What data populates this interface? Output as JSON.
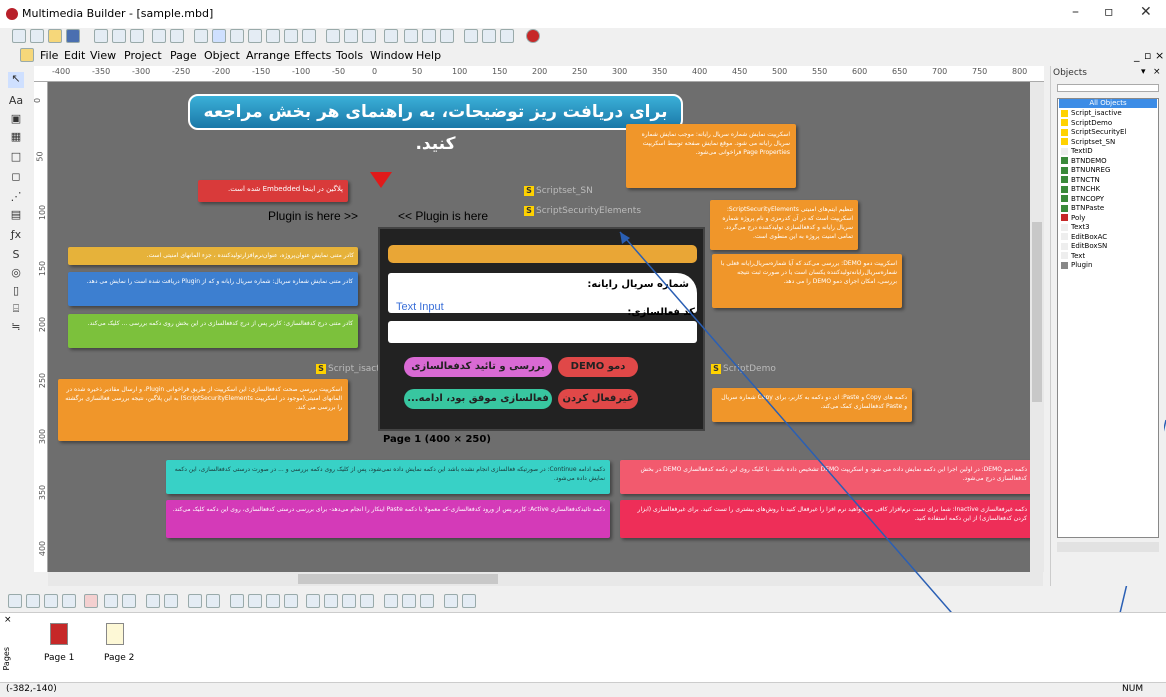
{
  "window": {
    "title": "Multimedia Builder - [sample.mbd]",
    "minimize": "–",
    "maximize": "▫",
    "close": "✕"
  },
  "menu": [
    "File",
    "Edit",
    "View",
    "Project",
    "Page",
    "Object",
    "Arrange",
    "Effects",
    "Tools",
    "Window",
    "Help"
  ],
  "ruler": [
    "-400",
    "-350",
    "-300",
    "-250",
    "-200",
    "-150",
    "-100",
    "-50",
    "0",
    "50",
    "100",
    "150",
    "200",
    "250",
    "300",
    "350",
    "400",
    "450",
    "500",
    "550",
    "600",
    "650",
    "700",
    "750",
    "800"
  ],
  "vruler": [
    "0",
    "50",
    "100",
    "150",
    "200",
    "250",
    "300",
    "350",
    "400"
  ],
  "canvas": {
    "banner": "برای دریافت ریز توضیحات، به راهنمای هر بخش مراجعه کنید.",
    "plugin_embedded_note": "پلاگین در اینجا Embedded شده است.",
    "plugin_left": "Plugin is here >>",
    "plugin_right": "<< Plugin is here",
    "script_sn": "Scriptset_SN",
    "script_security": "ScriptSecurityElements",
    "script_isactive": "Script_isactive",
    "script_demo": "ScriptDemo",
    "frame": {
      "serial_label": "شماره سریال رایانه:",
      "text_input": "Text Input",
      "activation_label": "کد فعالسازی:",
      "btn_demo": "دمو DEMO",
      "btn_check": "بررسی و تائید کدفعالسازی",
      "btn_disable": "غیرفعال کردن",
      "btn_success": "فعالسازی موفق بود، ادامه..."
    },
    "page_label": "Page 1 (400 × 250)",
    "notes": {
      "orange_top": "اسکریپت نمایش شماره سریال رایانه: موجب نمایش شماره سریال رایانه می شود. موقع نمایش صفحه توسط اسکریپت Page Properties فراخوانی می‌شود.",
      "orange_security": "تنظیم ایتم‌های امنیتی ScriptSecurityElements: اسکریپت است که در آن کدرمزی و نام پروژه شماره سریال رایانه و کدفعالسازی تولیدکننده درج می‌گردد. تمامی امنیت پروژه به این منطوی است.",
      "yellow_left": "کادر متنی نمایش عنوان‌پروژه، عنوان‌نرم‌افزار‌تولیدکننده ، جزء المانهای امنیتی است.",
      "blue_left": "کادر متنی نمایش شماره سریال: شماره سریال رایانه و که از Plugin دریافت شده است را نمایش می دهد.",
      "green_left": "کادر متنی درج کدفعالسازی: کاربر پس از درج کدفعالسازی در این بخش روی دکمه بررسی ... کلیک می‌کند.",
      "orange_left": "اسکریپت بررسی صحت کدفعالسازی: این اسکریپت از طریق فراخوانی Plugin، و ارسال مقادیر ذخیره شده در المانهای امنیتی(موجود در اسکریپت ScriptSecurityElements) به این پلاگین، نتیجه بررسی فعالسازی برگشته را بررسی می کند.",
      "orange_demo": "اسکریپت دمو DEMO: بررسی می‌کند که آیا شماره‌سریال‌رایانه فعلی با شماره‌سریال‌رایانه‌تولیدکننده یکسان است یا در صورت ثبت نتیجه بررسی، امکان اجرای دمو DEMO را می دهد.",
      "orange_copy": "دکمه های Copy و Paste: ای دو دکمه به کاربر، برای Copy شماره سریال و Paste کدفعالسازی کمک می‌کند.",
      "cyan_continue": "دکمه ادامه Continue: در صورتیکه فعالسازی انجام نشده باشد این دکمه نمایش داده نمی‌شود، پس از کلیک روی دکمه بررسی و ... در صورت درستی کدفعالسازی، این دکمه نمایش داده می‌شود.",
      "red_demo": "دکمه دمو DEMO: در اولین اجرا این دکمه نمایش داده می شود و اسکریپت DEMO تشخیص داده باشد. با کلیک روی این دکمه کدفعالسازی DEMO در بخش کدفعالسازی درج می‌شود.",
      "magenta_active": "دکمه تائیدکدفعالسازی Active: کاربر پس از ورود کدفعالسازی-که معمولا با دکمه Paste اینکار را انجام می‌دهد- برای بررسی درستی کدفعالسازی، روی این دکمه کلیک می‌کند.",
      "red_inactive": "دکمه غیرفعالسازی Inactive: شما برای تست نرم‌افزار کافی می‌خواهید نرم افزا را غیرفعال کنید تا روش‌های بیشتری را تست کنید. برای غیرفعالسازی (ابزار کردن کدفعالسازی) از این دکمه استفاده کنید."
    }
  },
  "objects_panel": {
    "header": "Objects",
    "selected": "All Objects",
    "items": [
      "Script_isactive",
      "ScriptDemo",
      "ScriptSecurityEl",
      "Scriptset_SN",
      "TextID",
      "BTNDEMO",
      "BTNUNREG",
      "BTNCTN",
      "BTNCHK",
      "BTNCOPY",
      "BTNPaste",
      "Poly",
      "Text3",
      "EditBoxAC",
      "EditBoxSN",
      "Text",
      "Plugin"
    ]
  },
  "pages": [
    "Page 1",
    "Page 2"
  ],
  "pages_tab": "Pages",
  "status": {
    "coords": "(-382,-140)",
    "num": "NUM"
  },
  "colors": {
    "orange": "#f0962a",
    "red": "#d93a3a",
    "blue": "#3d7fd0",
    "green": "#7cc13c",
    "cyan": "#38d1c6",
    "magenta": "#d43ab8",
    "pink": "#f25a6e",
    "canvas": "#6e6e6e"
  }
}
